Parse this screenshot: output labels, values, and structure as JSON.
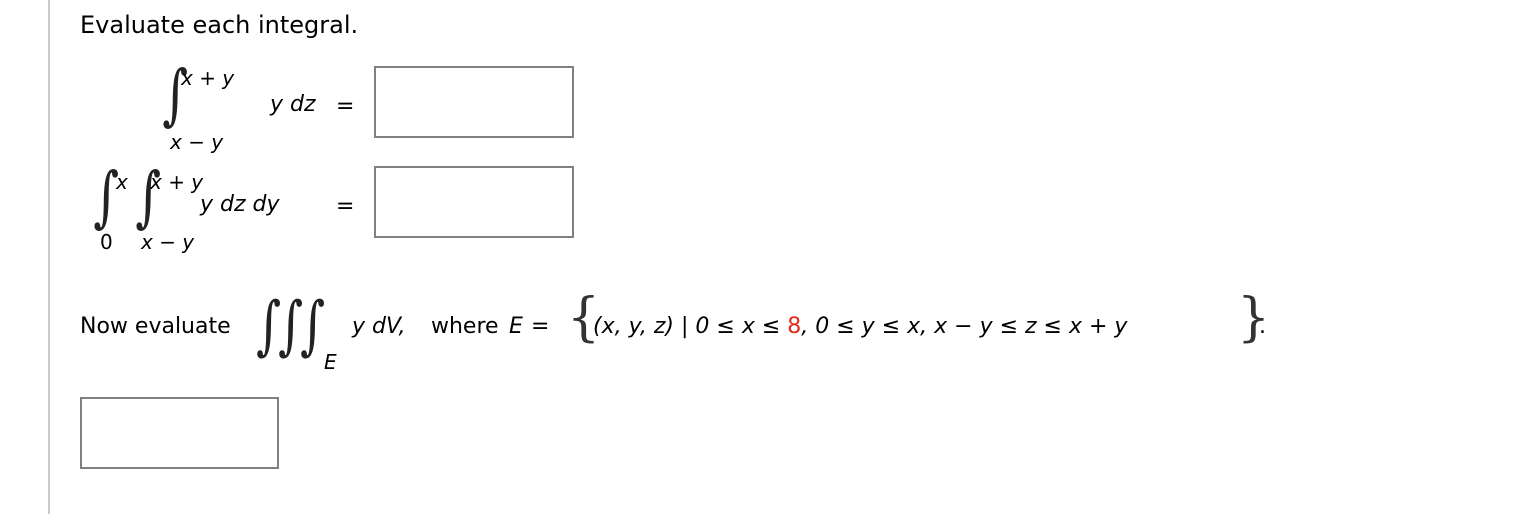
{
  "heading": "Evaluate each integral.",
  "integral1": {
    "upper": "x + y",
    "lower": "x − y",
    "integrand": "y dz",
    "equals": "=",
    "answer_value": ""
  },
  "integral2": {
    "outer_upper": "x",
    "outer_lower": "0",
    "inner_upper": "x + y",
    "inner_lower": "x − y",
    "integrand": "y dz dy",
    "equals": "=",
    "answer_value": ""
  },
  "part3": {
    "prefix": "Now evaluate",
    "region_sub": "E",
    "integrand": "y dV,",
    "where": "where",
    "E_symbol": "E",
    "equals": "=",
    "set_open": "(x, y, z) | 0 ≤ x ≤ ",
    "highlight_value": "8",
    "set_rest": ", 0 ≤ y ≤ x, x − y ≤ z ≤ x + y",
    "period": ".",
    "highlight_color": "#e2291b",
    "answer_value": ""
  }
}
